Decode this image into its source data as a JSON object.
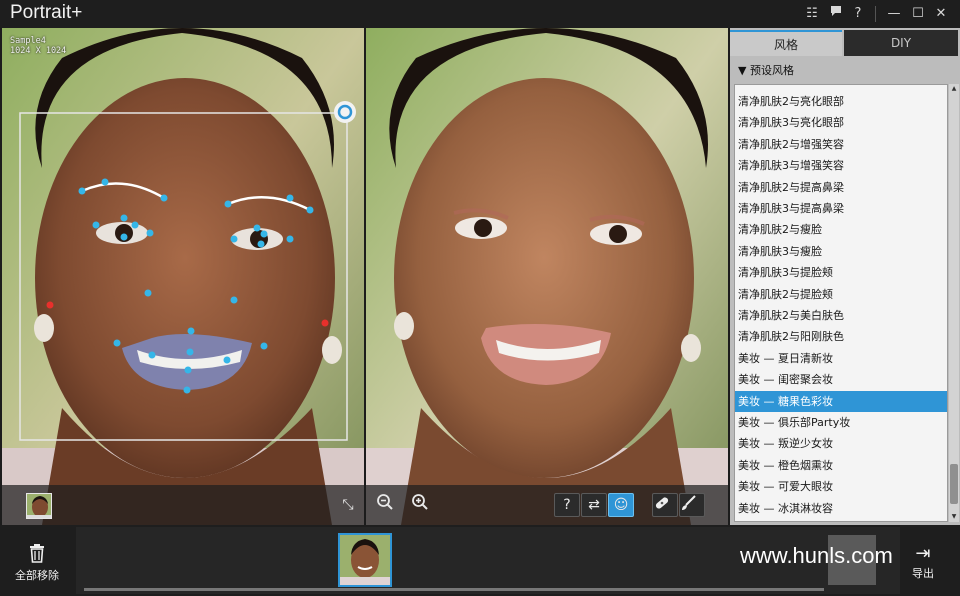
{
  "app": {
    "title": "Portrait+"
  },
  "titlebar": {
    "list_icon": "☷",
    "feedback_icon": "▾",
    "help_icon": "?",
    "minimize_icon": "—",
    "maximize_icon": "☐",
    "close_icon": "✕"
  },
  "image": {
    "name": "Sample4",
    "size": "1024 X 1024"
  },
  "left_toolbar": {
    "fit_icon": "⤡"
  },
  "right_toolbar": {
    "zoom_out": "−",
    "zoom_in": "+",
    "help": "?",
    "swap": "⇄",
    "face": "☺",
    "heal": "✚",
    "brush": "╱"
  },
  "panel": {
    "tab_style": "风格",
    "tab_diy": "DIY",
    "section": "▼  预设风格",
    "items": [
      "清净肌肤2与亮化眼部",
      "清净肌肤3与亮化眼部",
      "清净肌肤2与增强笑容",
      "清净肌肤3与增强笑容",
      "清净肌肤2与提高鼻梁",
      "清净肌肤3与提高鼻梁",
      "清净肌肤2与瘦脸",
      "清净肌肤3与瘦脸",
      "清净肌肤3与提脸颊",
      "清净肌肤2与提脸颊",
      "清净肌肤2与美白肤色",
      "清净肌肤2与阳刚肤色",
      "美妆 — 夏日清新妆",
      "美妆 — 闺密聚会妆",
      "美妆 — 糖果色彩妆",
      "美妆 — 俱乐部Party妆",
      "美妆 — 叛逆少女妆",
      "美妆 — 橙色烟熏妆",
      "美妆 — 可爱大眼妆",
      "美妆 — 冰淇淋妆容"
    ],
    "selected_index": 14
  },
  "bottom": {
    "remove_all_label": "全部移除",
    "remove_icon": "🗑",
    "export_label": "导出",
    "export_icon": "⇥",
    "watermark": "www.hunls.com"
  },
  "colors": {
    "accent": "#2f95d6",
    "landmark": "#35b6e8",
    "anchor": "#e8302c"
  }
}
